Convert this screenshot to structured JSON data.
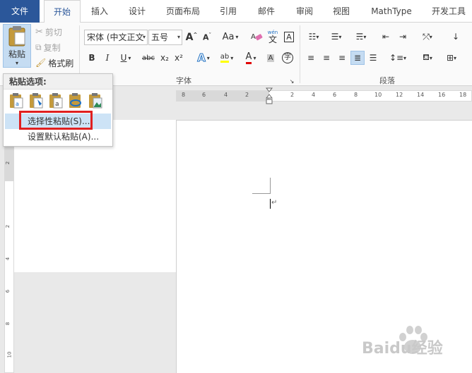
{
  "tabs": [
    "文件",
    "开始",
    "插入",
    "设计",
    "页面布局",
    "引用",
    "邮件",
    "审阅",
    "视图",
    "MathType",
    "开发工具"
  ],
  "clipboard": {
    "paste_label": "粘贴",
    "cut_label": "剪切",
    "copy_label": "复制",
    "format_painter_label": "格式刷"
  },
  "font": {
    "font_name": "宋体 (中文正文",
    "font_size": "五号",
    "group_label": "字体",
    "case_label": "Aa",
    "bold": "B",
    "italic": "I",
    "underline": "U",
    "strike": "abc",
    "subscript": "x₂",
    "superscript": "x²",
    "text_effect": "A",
    "font_color": "A",
    "enclose_char": "字",
    "phonetic_top": "wén",
    "phonetic_bottom": "文"
  },
  "paragraph": {
    "group_label": "段落"
  },
  "paste_menu": {
    "header": "粘贴选项:",
    "items": [
      "选择性粘贴(S)...",
      "设置默认粘贴(A)..."
    ]
  },
  "ruler": {
    "h_numbers": [
      "8",
      "6",
      "4",
      "2",
      "2",
      "4",
      "6",
      "8",
      "10",
      "12",
      "14",
      "16",
      "18"
    ],
    "v_numbers": [
      "2",
      "2",
      "4",
      "6",
      "8",
      "10"
    ]
  },
  "watermark": {
    "text": "Baidu经验"
  },
  "colors": {
    "file_tab": "#2b579a",
    "highlight": "#cde3f6",
    "red_box": "#e02020",
    "highlighter_yellow": "#ffff00",
    "font_red": "#e00000"
  }
}
